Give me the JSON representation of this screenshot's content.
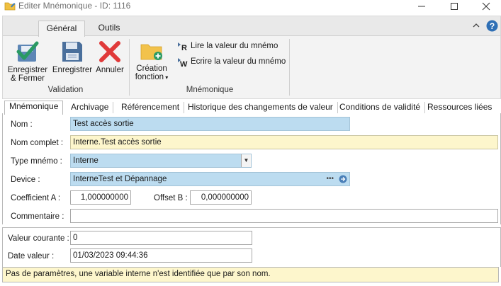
{
  "window": {
    "title": "Editer Mnémonique - ID: 1116",
    "controls": [
      "minimize",
      "maximize",
      "close"
    ]
  },
  "ribbon": {
    "tabs": [
      {
        "label": "Général",
        "active": true
      },
      {
        "label": "Outils",
        "active": false
      }
    ],
    "groups": {
      "validation": {
        "label": "Validation",
        "buttons": [
          {
            "line1": "Enregistrer",
            "line2": "& Fermer",
            "icon": "save-close-icon"
          },
          {
            "line1": "Enregistrer",
            "line2": "",
            "icon": "floppy-disk-icon"
          },
          {
            "line1": "Annuler",
            "line2": "",
            "icon": "cancel-x-icon"
          }
        ]
      },
      "mnemonique": {
        "label": "Mnémonique",
        "creation": {
          "line1": "Création",
          "line2": "fonction",
          "icon": "folder-add-icon"
        },
        "read": "Lire la valeur du mnémo",
        "write": "Ecrire la valeur du mnémo"
      }
    }
  },
  "form_tabs": [
    "Mnémonique",
    "Archivage",
    "Référencement",
    "Historique des changements de valeur",
    "Conditions de validité",
    "Ressources liées"
  ],
  "form": {
    "nom_label": "Nom :",
    "nom_value": "Test accès sortie",
    "nom_complet_label": "Nom complet :",
    "nom_complet_value": "Interne.Test accès sortie",
    "type_label": "Type mnémo :",
    "type_value": "Interne",
    "device_label": "Device :",
    "device_value": "InterneTest et Dépannage",
    "coef_a_label": "Coefficient A :",
    "coef_a_value": "1,000000000",
    "offset_b_label": "Offset B :",
    "offset_b_value": "0,000000000",
    "commentaire_label": "Commentaire :",
    "commentaire_value": ""
  },
  "values": {
    "courante_label": "Valeur courante :",
    "courante_value": "0",
    "date_label": "Date valeur :",
    "date_value": "01/03/2023 09:44:36"
  },
  "status_text": "Pas de paramètres, une variable interne n'est identifiée que par son nom.",
  "colors": {
    "field_blue": "#bcdcf0",
    "field_yellow": "#fdf6cc",
    "accent_green": "#2a9a63",
    "accent_red": "#e03a3a",
    "floppy_blue": "#4a6f9c"
  }
}
